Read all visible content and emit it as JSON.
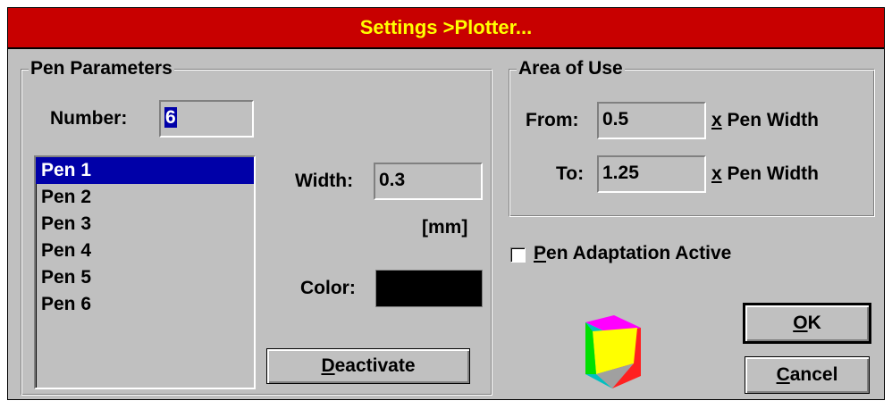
{
  "dialog": {
    "title": "Settings >Plotter...",
    "title_bg": "#c80000",
    "title_color": "#ffff00"
  },
  "pen_parameters": {
    "group_title": "Pen Parameters",
    "number_label": "Number:",
    "number_value": "6",
    "pens": [
      "Pen 1",
      "Pen 2",
      "Pen 3",
      "Pen 4",
      "Pen 5",
      "Pen 6"
    ],
    "selected_pen": "Pen 1",
    "width_label": "Width:",
    "width_value": "0.3",
    "width_unit": "[mm]",
    "color_label": "Color:",
    "color_value": "#000000",
    "deactivate_mnemonic": "D",
    "deactivate_rest": "eactivate"
  },
  "area_of_use": {
    "group_title": "Area of Use",
    "from_label": "From:",
    "from_value": "0.5",
    "to_label": "To:",
    "to_value": "1.25",
    "suffix_x": "x",
    "suffix_text": " Pen Width"
  },
  "adaptation": {
    "mnemonic": "P",
    "rest": "en Adaptation Active",
    "checked": false
  },
  "buttons": {
    "ok_mnemonic": "O",
    "ok_rest": "K",
    "cancel_mnemonic": "C",
    "cancel_rest": "ancel"
  },
  "icons": {
    "logo": "colored-cube-icon"
  }
}
